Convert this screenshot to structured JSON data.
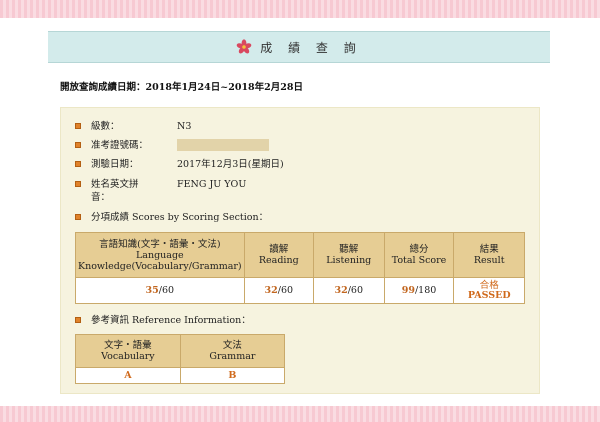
{
  "header": {
    "title": "成 績 查 詢"
  },
  "period": "開放查詢成績日期：2018年1月24日~2018年2月28日",
  "info": [
    {
      "label": "級數：",
      "value": "N3"
    },
    {
      "label": "准考證號碼：",
      "value": ""
    },
    {
      "label": "測驗日期：",
      "value": "2017年12月3日(星期日)"
    },
    {
      "label": "姓名英文拼音：",
      "value": "FENG JU YOU"
    }
  ],
  "scores_section": {
    "heading": "分項成績 Scores by Scoring Section：",
    "headers": [
      {
        "zh": "言語知識(文字‧語彙‧文法)",
        "en": "Language Knowledge(Vocabulary/Grammar)"
      },
      {
        "zh": "讀解",
        "en": "Reading"
      },
      {
        "zh": "聽解",
        "en": "Listening"
      },
      {
        "zh": "總分",
        "en": "Total Score"
      },
      {
        "zh": "結果",
        "en": "Result"
      }
    ],
    "scores": [
      {
        "got": "35",
        "max": "/60"
      },
      {
        "got": "32",
        "max": "/60"
      },
      {
        "got": "32",
        "max": "/60"
      },
      {
        "got": "99",
        "max": "/180"
      }
    ],
    "result": {
      "zh": "合格",
      "en": "PASSED"
    }
  },
  "reference": {
    "heading": "參考資訊 Reference Information：",
    "headers": [
      {
        "zh": "文字‧語彙",
        "en": "Vocabulary"
      },
      {
        "zh": "文法",
        "en": "Grammar"
      }
    ],
    "grades": [
      "A",
      "B"
    ]
  },
  "colors": {
    "accent": "#d06a1c",
    "header_bg": "#e6cd94",
    "panel_bg": "#f6f3df",
    "title_bg": "#d3ebeb"
  }
}
